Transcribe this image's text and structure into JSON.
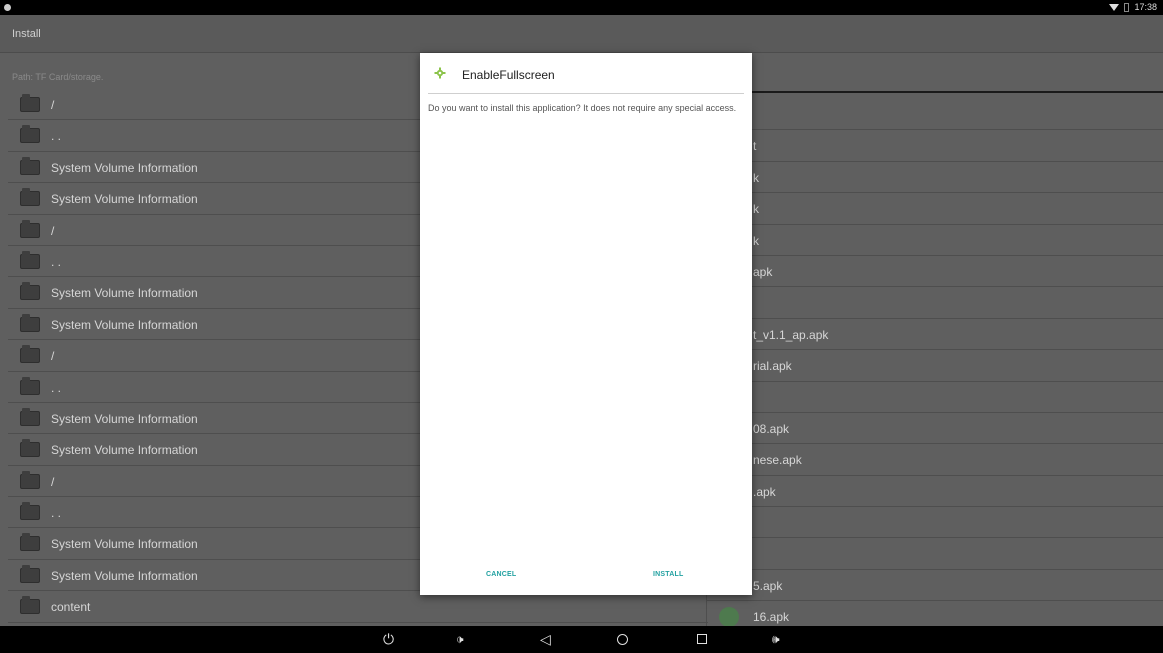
{
  "status_bar": {
    "time": "17:38"
  },
  "app": {
    "title": "Install",
    "path": "Path:  TF Card/storage."
  },
  "left_list": [
    {
      "label": "/"
    },
    {
      "label": ". ."
    },
    {
      "label": "System Volume Information"
    },
    {
      "label": "System Volume Information"
    },
    {
      "label": "/"
    },
    {
      "label": ". ."
    },
    {
      "label": "System Volume Information"
    },
    {
      "label": "System Volume Information"
    },
    {
      "label": "/"
    },
    {
      "label": ". ."
    },
    {
      "label": "System Volume Information"
    },
    {
      "label": "System Volume Information"
    },
    {
      "label": "/"
    },
    {
      "label": ". ."
    },
    {
      "label": "System Volume Information"
    },
    {
      "label": "System Volume Information"
    },
    {
      "label": "content"
    }
  ],
  "right_list": [
    {
      "label": ""
    },
    {
      "label": "t"
    },
    {
      "label": "k"
    },
    {
      "label": "k"
    },
    {
      "label": "k"
    },
    {
      "label": "apk"
    },
    {
      "label": ""
    },
    {
      "label": "t_v1.1_ap.apk"
    },
    {
      "label": "rial.apk"
    },
    {
      "label": ""
    },
    {
      "label": "08.apk"
    },
    {
      "label": "nese.apk"
    },
    {
      "label": ".apk"
    },
    {
      "label": ""
    },
    {
      "label": ""
    },
    {
      "label": "5.apk"
    },
    {
      "label": "16.apk"
    }
  ],
  "dialog": {
    "title": "EnableFullscreen",
    "message": "Do you want to install this application? It does not require any special access.",
    "cancel_label": "CANCEL",
    "install_label": "INSTALL",
    "accent_color": "#22a1a1"
  },
  "nav_bar": {
    "power_icon": "⏻",
    "vol_down_icon": "🕩",
    "back_icon": "◁",
    "vol_up_icon": "🕪"
  }
}
